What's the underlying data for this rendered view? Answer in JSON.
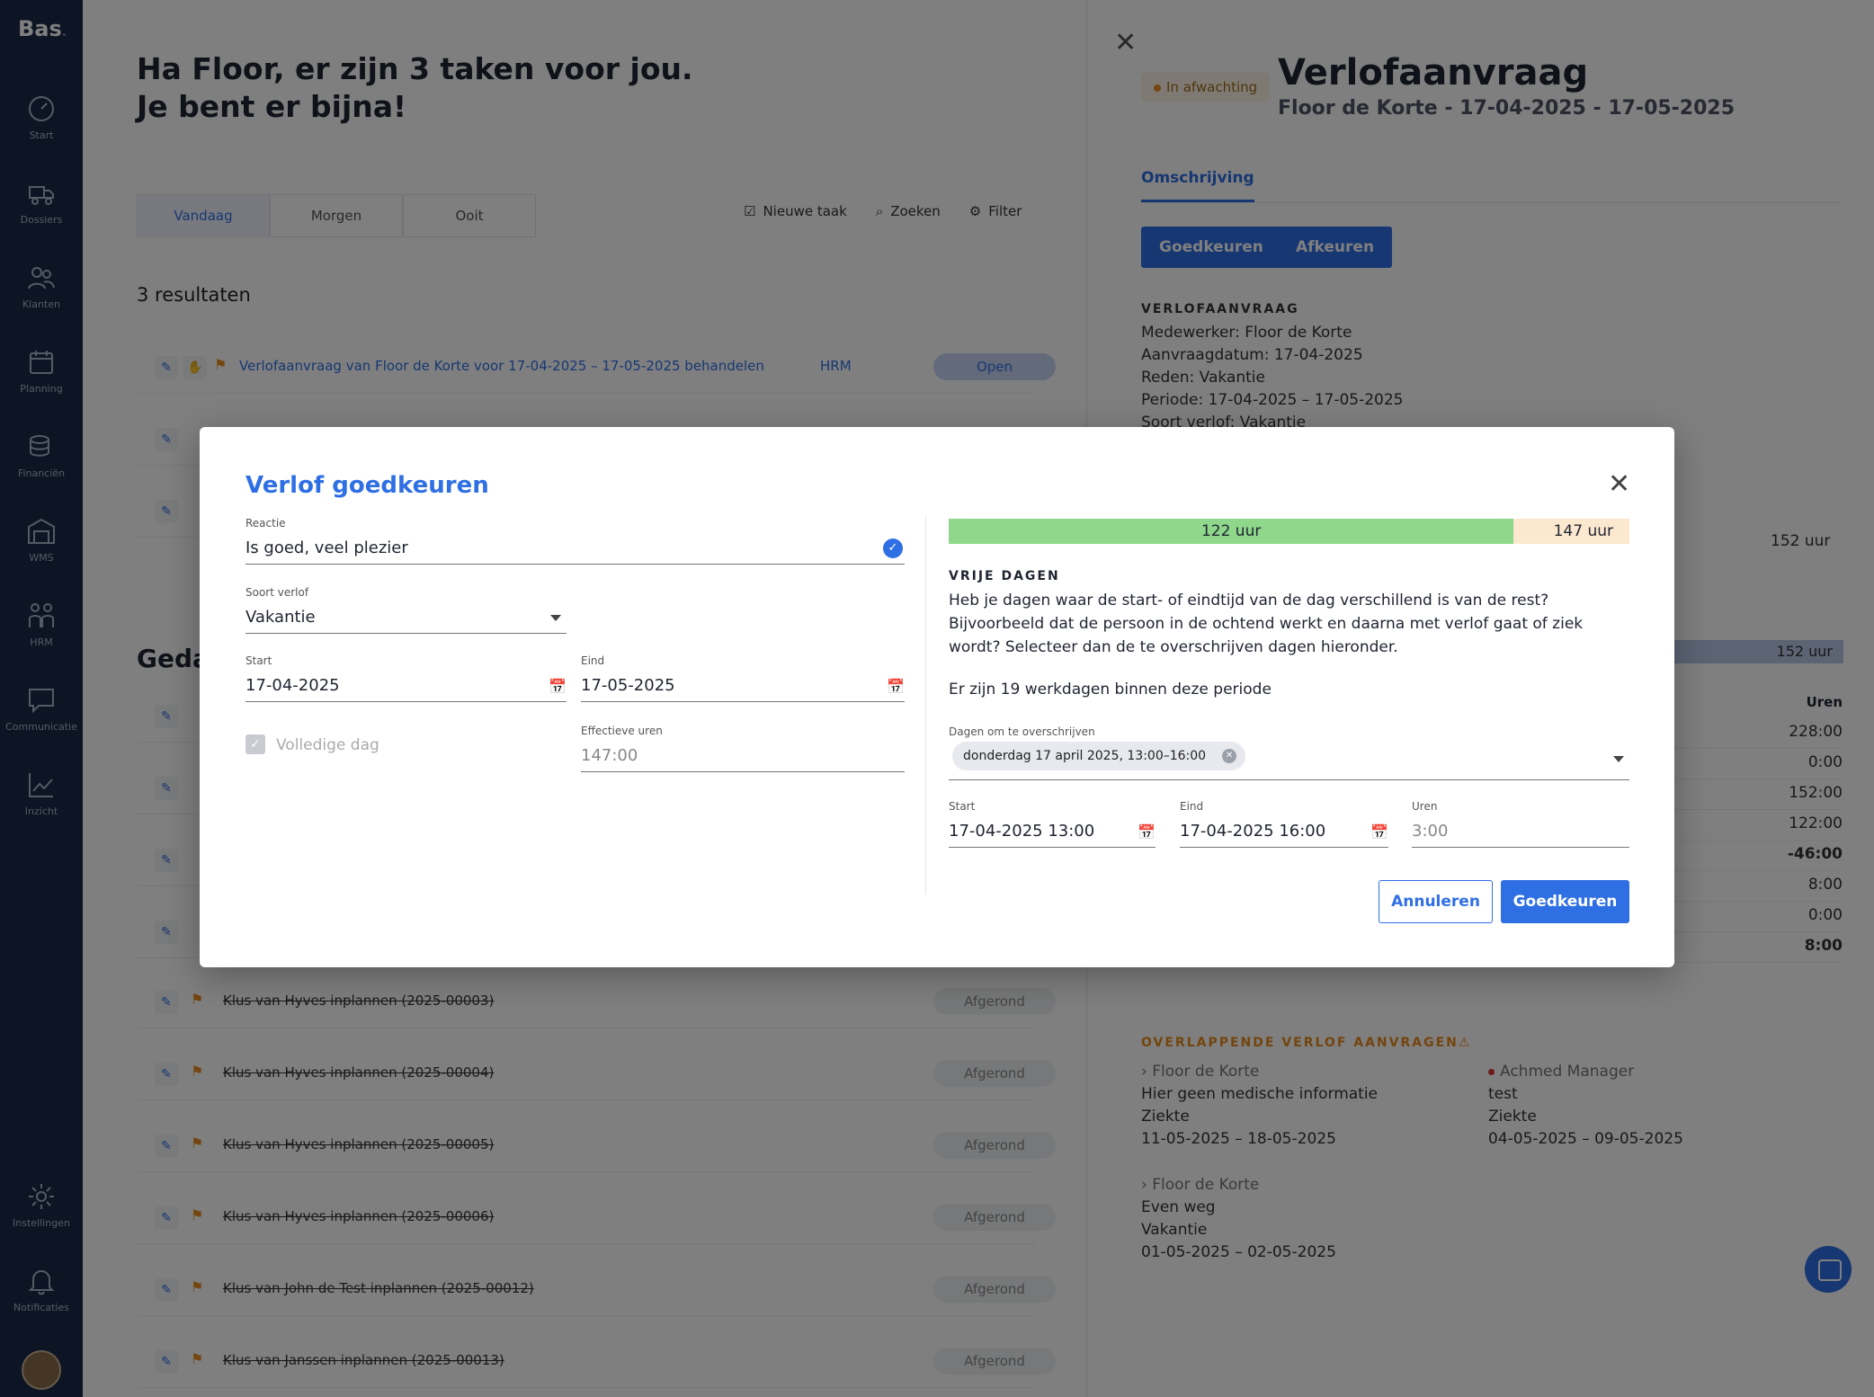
{
  "app": {
    "logo": "Bas",
    "logo_dot": "."
  },
  "sidebar": {
    "items": [
      {
        "label": "Start",
        "icon": "gauge-icon"
      },
      {
        "label": "Dossiers",
        "icon": "truck-icon"
      },
      {
        "label": "Klanten",
        "icon": "customers-icon"
      },
      {
        "label": "Planning",
        "icon": "calendar-icon"
      },
      {
        "label": "Financiën",
        "icon": "coins-icon"
      },
      {
        "label": "WMS",
        "icon": "warehouse-icon"
      },
      {
        "label": "HRM",
        "icon": "people-icon"
      },
      {
        "label": "Communicatie",
        "icon": "chat-icon"
      },
      {
        "label": "Inzicht",
        "icon": "chart-icon"
      },
      {
        "label": "Instellingen",
        "icon": "gear-icon"
      },
      {
        "label": "Notificaties",
        "icon": "bell-icon"
      }
    ]
  },
  "main": {
    "greeting": "Ha Floor, er zijn 3 taken voor jou. Je bent er bijna!",
    "tabs": [
      "Vandaag",
      "Morgen",
      "Ooit"
    ],
    "actions": {
      "new_task": "Nieuwe taak",
      "search": "Zoeken",
      "filter": "Filter"
    },
    "results": "3 resultaten",
    "open_task": {
      "title": "Verlofaanvraag van Floor de Korte voor 17-04-2025 – 17-05-2025 behandelen",
      "dept": "HRM",
      "status": "Open"
    },
    "section_partial": "Geda",
    "done_tasks": [
      {
        "title": "Klus van Hyves inplannen (2025-00003)",
        "status": "Afgerond"
      },
      {
        "title": "Klus van Hyves inplannen (2025-00004)",
        "status": "Afgerond"
      },
      {
        "title": "Klus van Hyves inplannen (2025-00005)",
        "status": "Afgerond"
      },
      {
        "title": "Klus van Hyves inplannen (2025-00006)",
        "status": "Afgerond"
      },
      {
        "title": "Klus van John de Test inplannen (2025-00012)",
        "status": "Afgerond"
      },
      {
        "title": "Klus van Janssen inplannen (2025-00013)",
        "status": "Afgerond"
      }
    ]
  },
  "panel": {
    "badge": "In afwachting",
    "title": "Verlofaanvraag",
    "subtitle": "Floor de Korte - 17-04-2025 - 17-05-2025",
    "tab": "Omschrijving",
    "approve": "Goedkeuren",
    "reject": "Afkeuren",
    "section": "VERLOFAANVRAAG",
    "lines": [
      "Medewerker: Floor de Korte",
      "Aanvraagdatum: 17-04-2025",
      "Reden: Vakantie",
      "Periode: 17-04-2025 – 17-05-2025",
      "Soort verlof: Vakantie"
    ],
    "hours_label": "152 uur",
    "bar_label": "152 uur",
    "col_head": "Uren",
    "values": [
      "228:00",
      "0:00",
      "152:00",
      "122:00",
      "-46:00",
      "8:00",
      "0:00",
      "8:00"
    ],
    "overlap_head": "OVERLAPPENDE VERLOF AANVRAGEN⚠",
    "overlaps": [
      {
        "name": "Floor de Korte",
        "note": "Hier geen medische informatie",
        "type": "Ziekte",
        "period": "11-05-2025 – 18-05-2025"
      },
      {
        "name": "Achmed Manager",
        "note": "test",
        "type": "Ziekte",
        "period": "04-05-2025 – 09-05-2025"
      },
      {
        "name": "Floor de Korte",
        "note": "Even weg",
        "type": "Vakantie",
        "period": "01-05-2025 – 02-05-2025"
      }
    ]
  },
  "modal": {
    "title": "Verlof goedkeuren",
    "reactie_label": "Reactie",
    "reactie_value": "Is goed, veel plezier",
    "soort_label": "Soort verlof",
    "soort_value": "Vakantie",
    "start_label": "Start",
    "start_value": "17-04-2025",
    "eind_label": "Eind",
    "eind_value": "17-05-2025",
    "fullday_label": "Volledige dag",
    "effective_label": "Effectieve uren",
    "effective_value": "147:00",
    "hours_used": "122 uur",
    "hours_total": "147 uur",
    "hours_used_fraction": 0.83,
    "vd_head": "VRIJE DAGEN",
    "vd_text": "Heb je dagen waar de start- of eindtijd van de dag verschillend is van de rest? Bijvoorbeeld dat de persoon in de ochtend werkt en daarna met verlof gaat of ziek wordt? Selecteer dan de te overschrijven dagen hieronder.",
    "vd_count": "Er zijn 19 werkdagen binnen deze periode",
    "override_label": "Dagen om te overschrijven",
    "chip": "donderdag 17 april 2025, 13:00–16:00",
    "o_start_label": "Start",
    "o_start_value": "17-04-2025 13:00",
    "o_eind_label": "Eind",
    "o_eind_value": "17-04-2025 16:00",
    "o_uren_label": "Uren",
    "o_uren_value": "3:00",
    "cancel": "Annuleren",
    "confirm": "Goedkeuren"
  }
}
